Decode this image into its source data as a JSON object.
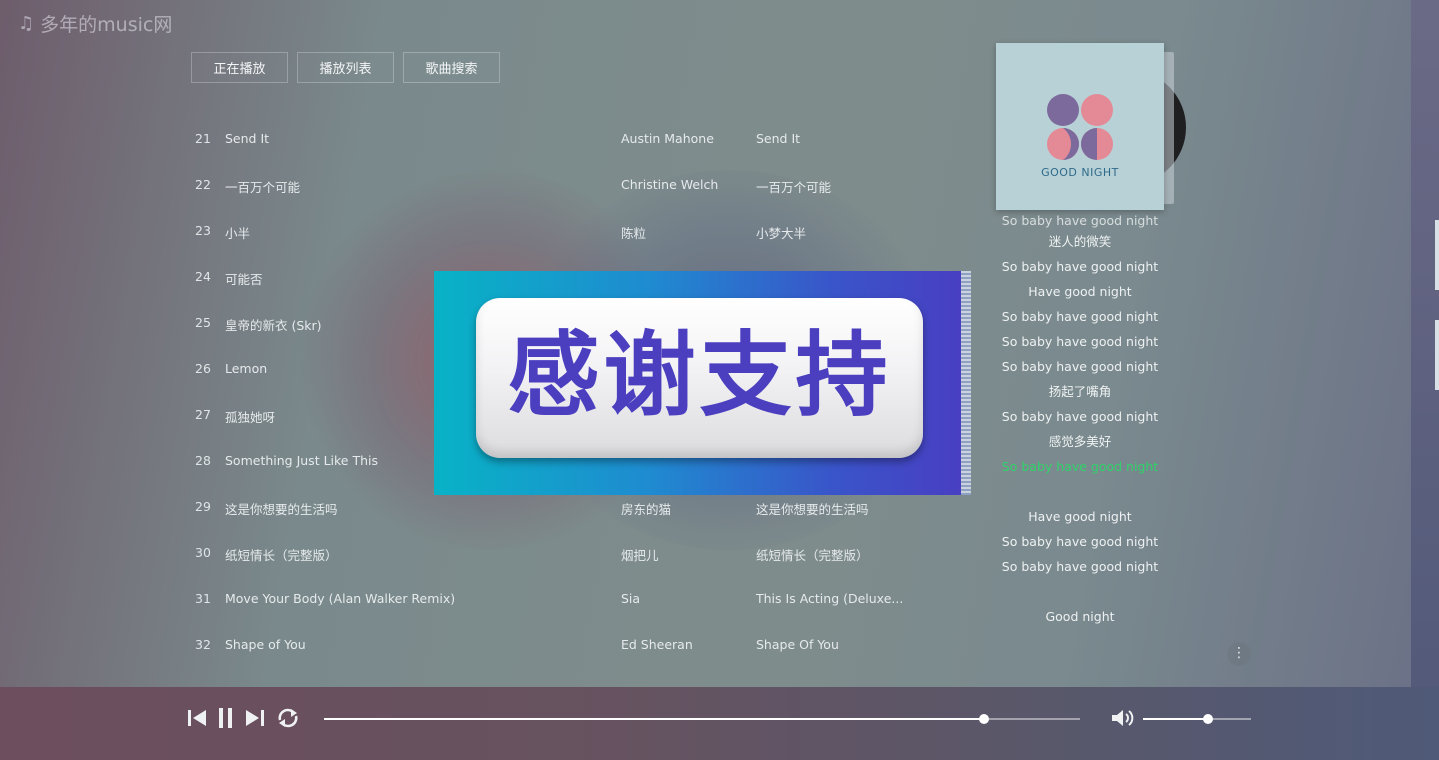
{
  "app": {
    "logo_icon": "music-note-icon",
    "title": "多年的music网"
  },
  "tabs": [
    {
      "label": "正在播放"
    },
    {
      "label": "播放列表"
    },
    {
      "label": "歌曲搜索"
    }
  ],
  "songs": [
    {
      "num": "21",
      "title": "Send It",
      "artist": "Austin Mahone",
      "album": "Send It"
    },
    {
      "num": "22",
      "title": "一百万个可能",
      "artist": "Christine Welch",
      "album": "一百万个可能"
    },
    {
      "num": "23",
      "title": "小半",
      "artist": "陈粒",
      "album": "小梦大半"
    },
    {
      "num": "24",
      "title": "可能否",
      "artist": "",
      "album": ""
    },
    {
      "num": "25",
      "title": "皇帝的新衣 (Skr)",
      "artist": "",
      "album": ""
    },
    {
      "num": "26",
      "title": "Lemon",
      "artist": "",
      "album": ""
    },
    {
      "num": "27",
      "title": "孤独她呀",
      "artist": "",
      "album": ""
    },
    {
      "num": "28",
      "title": "Something Just Like This",
      "artist": "",
      "album": ""
    },
    {
      "num": "29",
      "title": "这是你想要的生活吗",
      "artist": "房东的猫",
      "album": "这是你想要的生活吗"
    },
    {
      "num": "30",
      "title": "纸短情长（完整版）",
      "artist": "烟把儿",
      "album": "纸短情长（完整版）"
    },
    {
      "num": "31",
      "title": "Move Your Body (Alan Walker Remix)",
      "artist": "Sia",
      "album": "This Is Acting (Deluxe..."
    },
    {
      "num": "32",
      "title": "Shape of You",
      "artist": "Ed Sheeran",
      "album": "Shape Of You"
    }
  ],
  "now_playing": {
    "cover_text": "GOOD NIGHT",
    "cover_bg": "#b7d1d6",
    "cover_circle_colors": [
      "#7d6a9c",
      "#e48a96"
    ]
  },
  "lyrics": [
    {
      "text": "So baby have good night",
      "state": "first"
    },
    {
      "text": "迷人的微笑",
      "state": "normal"
    },
    {
      "text": "So baby have good night",
      "state": "normal"
    },
    {
      "text": "Have good night",
      "state": "normal"
    },
    {
      "text": "So baby have good night",
      "state": "normal"
    },
    {
      "text": "So baby have good night",
      "state": "normal"
    },
    {
      "text": "So baby have good night",
      "state": "normal"
    },
    {
      "text": "扬起了嘴角",
      "state": "normal"
    },
    {
      "text": "So baby have good night",
      "state": "normal"
    },
    {
      "text": "感觉多美好",
      "state": "normal"
    },
    {
      "text": "So baby have good night",
      "state": "active"
    },
    {
      "text": "",
      "state": "normal"
    },
    {
      "text": "Have good night",
      "state": "normal"
    },
    {
      "text": "So baby have good night",
      "state": "normal"
    },
    {
      "text": "So baby have good night",
      "state": "normal"
    },
    {
      "text": "",
      "state": "normal"
    },
    {
      "text": "Good night",
      "state": "normal"
    }
  ],
  "more_button": {
    "icon": "more-vertical-icon",
    "glyph": "⋮"
  },
  "overlay": {
    "text": "感谢支持"
  },
  "player": {
    "controls": [
      "previous-icon",
      "pause-icon",
      "next-icon",
      "loop-icon",
      "volume-icon"
    ],
    "progress_fraction": 0.873,
    "volume_fraction": 0.6
  },
  "colors": {
    "lyric_active": "#2fd36a",
    "overlay_text": "#4b3fc0"
  }
}
